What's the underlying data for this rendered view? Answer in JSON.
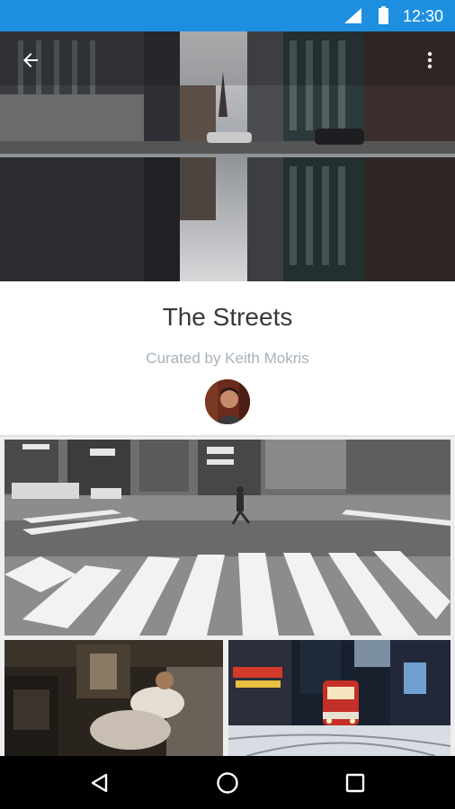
{
  "status_bar": {
    "time": "12:30",
    "signal_icon": "cell-signal-icon",
    "battery_icon": "battery-icon",
    "color": "#1e8fe0"
  },
  "toolbar": {
    "back_icon": "arrow-back-icon",
    "menu_icon": "more-vert-icon"
  },
  "collection": {
    "title": "The Streets",
    "subtitle": "Curated by Keith Mokris",
    "avatar_icon": "curator-avatar"
  },
  "gallery": {
    "photos": [
      {
        "name": "photo-crosswalk",
        "tone": "black-and-white"
      },
      {
        "name": "photo-train-interior",
        "tone": "dark-warm"
      },
      {
        "name": "photo-streetcar-night",
        "tone": "dark-cool"
      }
    ]
  },
  "nav_bar": {
    "back_icon": "nav-back-triangle-icon",
    "home_icon": "nav-home-circle-icon",
    "recents_icon": "nav-recents-square-icon"
  },
  "colors": {
    "status_bar": "#1e8fe0",
    "title_text": "#3a3a3a",
    "subtitle_text": "#a7b1bb",
    "nav_bar": "#000000"
  }
}
